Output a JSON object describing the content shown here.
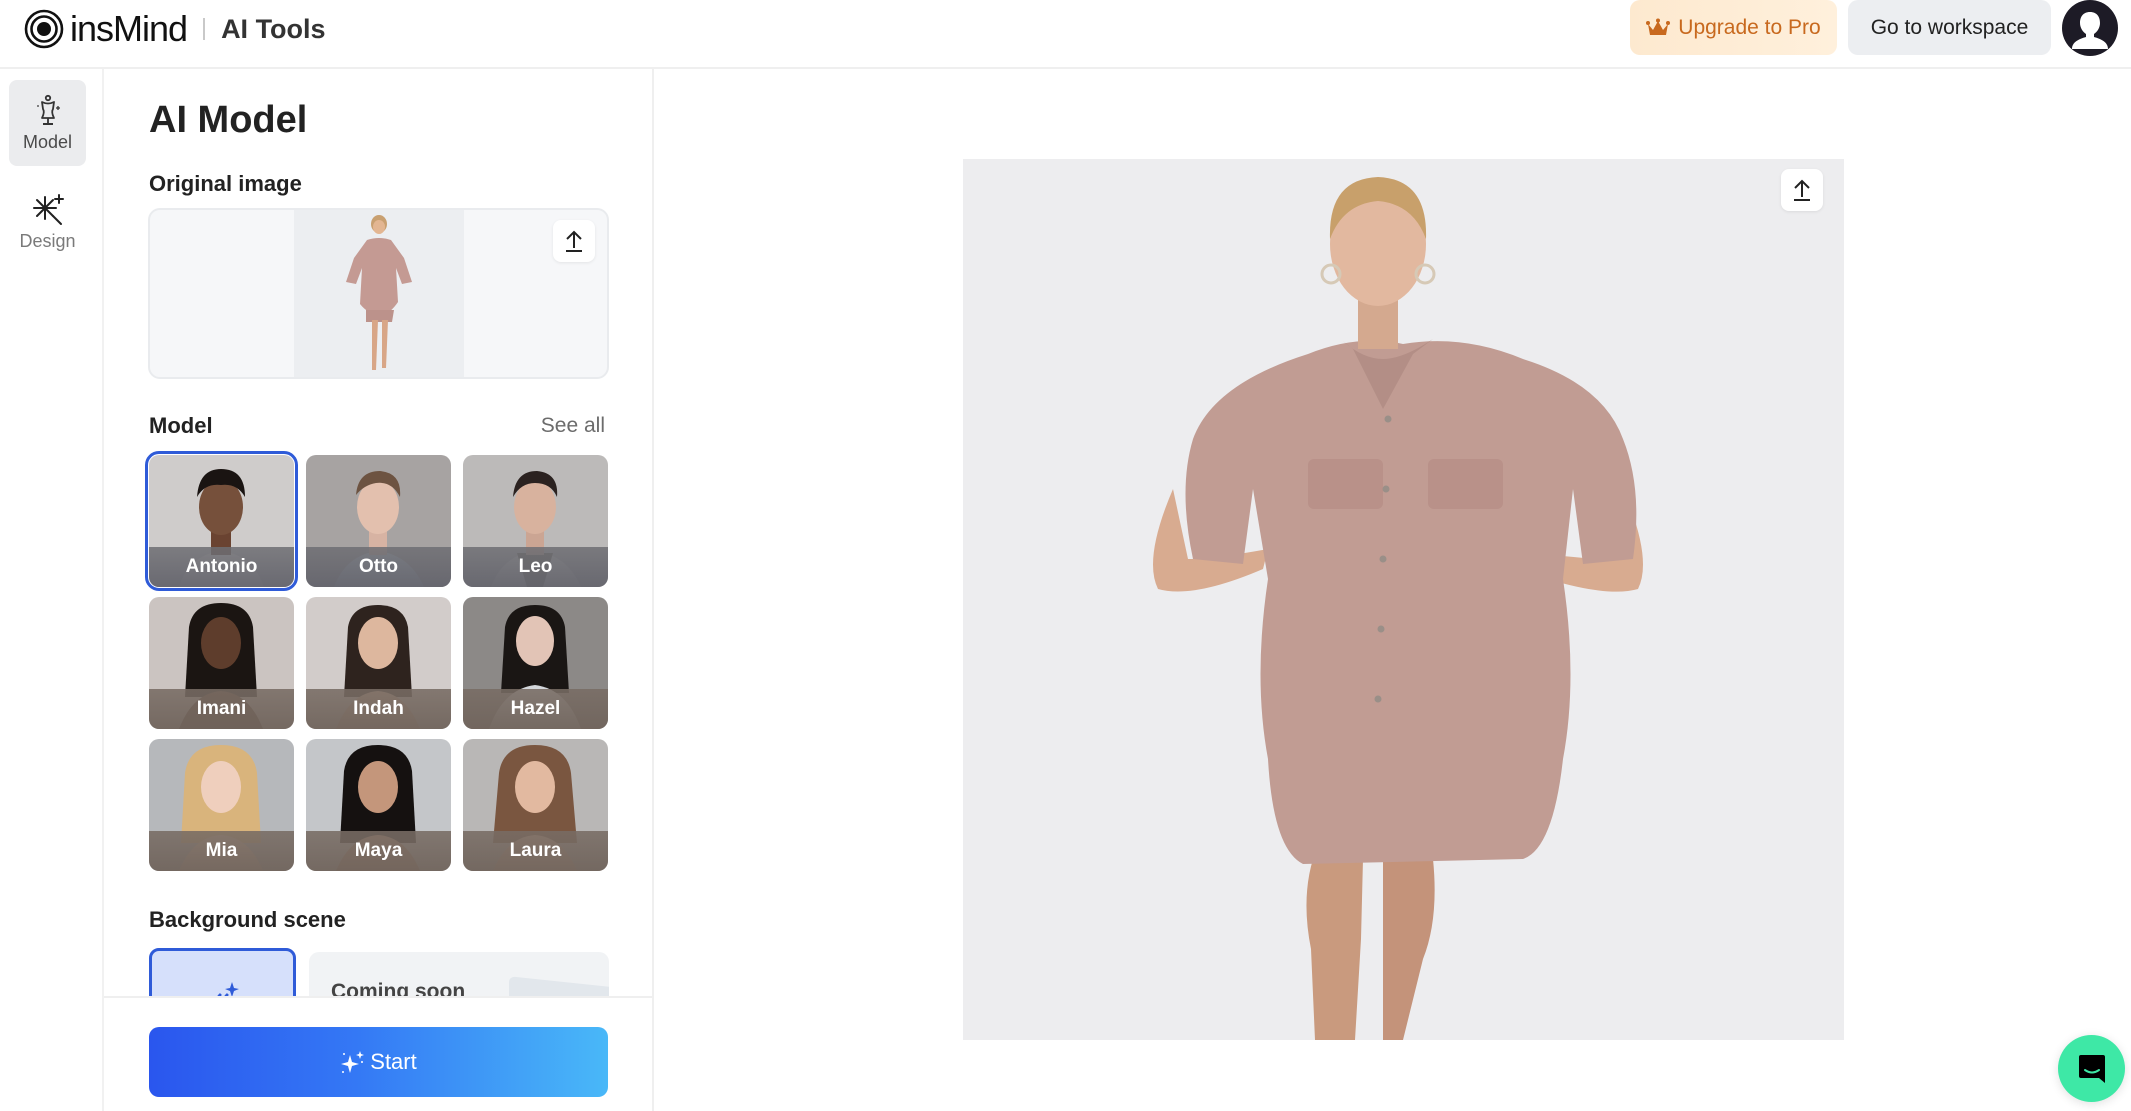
{
  "header": {
    "brand": "insMind",
    "section": "AI Tools",
    "upgrade_label": "Upgrade to Pro",
    "workspace_label": "Go to workspace",
    "upgrade_color": "#c8691e"
  },
  "rail": {
    "items": [
      {
        "label": "Model",
        "icon": "dress-form-icon",
        "active": true
      },
      {
        "label": "Design",
        "icon": "magic-wand-icon",
        "active": false
      }
    ]
  },
  "panel": {
    "title": "AI Model",
    "original_image_label": "Original image",
    "model_label": "Model",
    "see_all_label": "See all",
    "models": [
      {
        "name": "Antonio",
        "selected": true
      },
      {
        "name": "Otto",
        "selected": false
      },
      {
        "name": "Leo",
        "selected": false
      },
      {
        "name": "Imani",
        "selected": false
      },
      {
        "name": "Indah",
        "selected": false
      },
      {
        "name": "Hazel",
        "selected": false
      },
      {
        "name": "Mia",
        "selected": false
      },
      {
        "name": "Maya",
        "selected": false
      },
      {
        "name": "Laura",
        "selected": false
      }
    ],
    "background_label": "Background scene",
    "background_options": [
      {
        "label": "",
        "icon": "ai-generate-icon",
        "selected": true
      },
      {
        "label": "Coming soon",
        "selected": false
      }
    ],
    "start_label": "Start",
    "accent": "#2f5bd8"
  },
  "preview": {
    "background": "#ededef",
    "subject": "model wearing dusty pink shirt dress"
  }
}
